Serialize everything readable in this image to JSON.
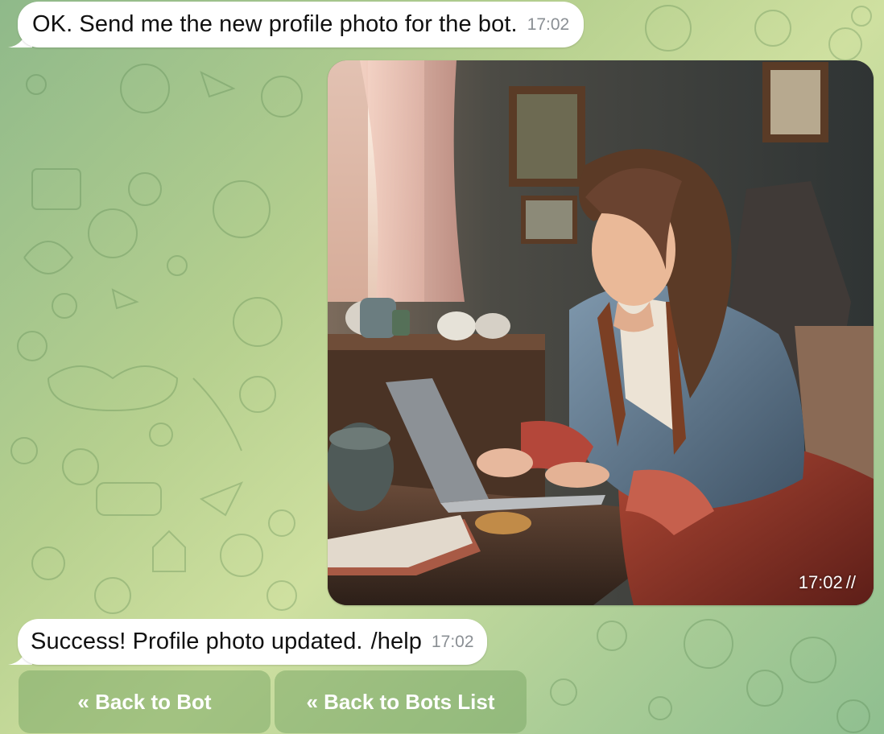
{
  "chat": {
    "messages": [
      {
        "type": "incoming_text",
        "text": "OK. Send me the new profile photo for the bot.",
        "time": "17:02"
      },
      {
        "type": "outgoing_photo",
        "caption_time": "17:02",
        "status_icon": "double-check-icon",
        "checks": "//"
      },
      {
        "type": "incoming_text",
        "text": "Success! Profile photo updated.",
        "link": "/help",
        "time": "17:02"
      }
    ]
  },
  "keyboard": {
    "buttons": [
      {
        "label": "« Back to Bot"
      },
      {
        "label": "« Back to Bots List"
      }
    ]
  },
  "colors": {
    "background_start": "#8fb98a",
    "background_end": "#cfe0a0",
    "bubble_in": "#ffffff",
    "link": "#1d61a8",
    "keyboard_button": "#7eaa68"
  }
}
